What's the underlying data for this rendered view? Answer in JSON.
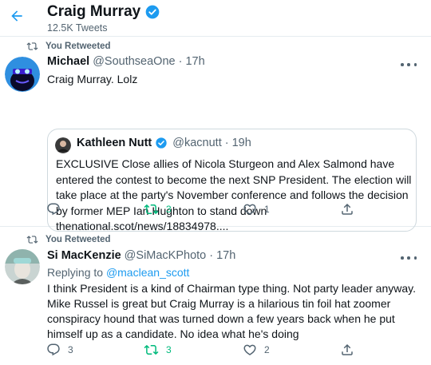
{
  "header": {
    "title": "Craig Murray",
    "subtitle": "12.5K Tweets"
  },
  "tweets": [
    {
      "retweet_label": "You Retweeted",
      "name": "Michael",
      "handle": "@SouthseaOne",
      "separator": "·",
      "time": "17h",
      "text": "Craig Murray. Lolz",
      "quote": {
        "name": "Kathleen Nutt",
        "handle": "@kacnutt",
        "separator": "·",
        "time": "19h",
        "text": "EXCLUSIVE Close allies of Nicola Sturgeon and Alex Salmond have entered the contest to become the next SNP President. The election will take place at the party's November conference and follows the decision by former MEP Ian Hughton to stand down",
        "link": "thenational.scot/news/18834978...."
      },
      "actions": {
        "reply": "",
        "retweet": "3",
        "like": "1",
        "share": ""
      }
    },
    {
      "retweet_label": "You Retweeted",
      "name": "Si MacKenzie",
      "handle": "@SiMacKPhoto",
      "separator": "·",
      "time": "17h",
      "reply_prefix": "Replying to",
      "reply_to": "@maclean_scott",
      "text": "I think President is a kind of Chairman type thing. Not party leader anyway. Mike Russel is great but Craig Murray is a hilarious tin foil hat zoomer conspiracy hound that was turned down a few years back when he put himself up as a candidate. No idea what he's doing",
      "actions": {
        "reply": "3",
        "retweet": "3",
        "like": "2",
        "share": ""
      }
    }
  ],
  "colors": {
    "accent_blue": "#1d9bf0",
    "retweet_green": "#00ba7c",
    "secondary_text": "#536471",
    "primary_text": "#0f1419"
  },
  "icons": {
    "back": "arrow-left-icon",
    "verified": "verified-badge-icon",
    "retweeted": "retweet-icon",
    "more": "more-horizontal-icon",
    "reply": "reply-icon",
    "like": "heart-icon",
    "share": "share-icon"
  }
}
